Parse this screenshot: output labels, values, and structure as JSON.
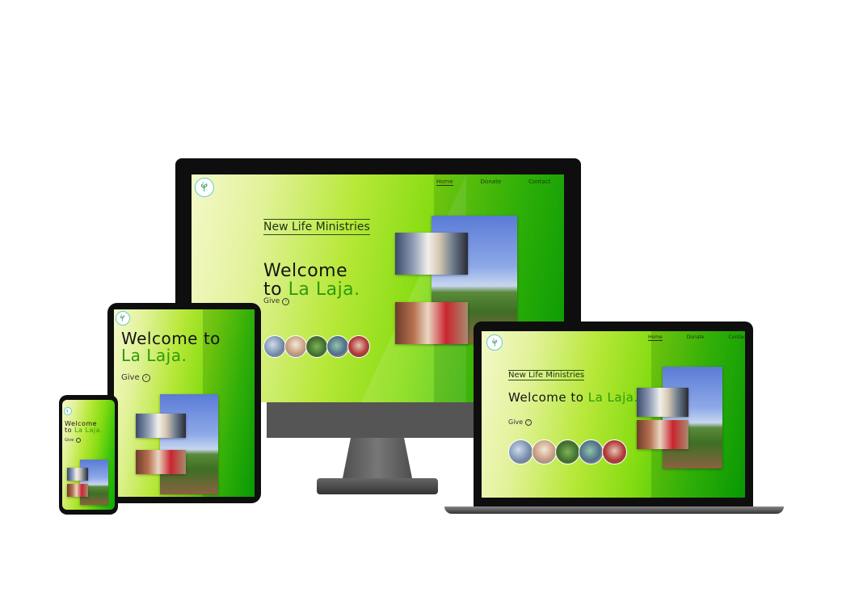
{
  "site": {
    "brand": "New Life Ministries",
    "welcome_line1": "Welcome",
    "welcome_to": "to",
    "welcome_place": "La Laja.",
    "welcome_to_inline": "Welcome to",
    "give": "Give",
    "give_icon": "⊕"
  },
  "nav": {
    "home": "Home",
    "donate": "Donate",
    "contact": "Contact"
  },
  "colors": {
    "accent_green": "#2f9a0b",
    "bezel": "#0e0e0e",
    "stand": "#7a7a7a"
  },
  "icons": {
    "logo": "sprout-logo-icon",
    "give": "circle-arrow-icon"
  }
}
